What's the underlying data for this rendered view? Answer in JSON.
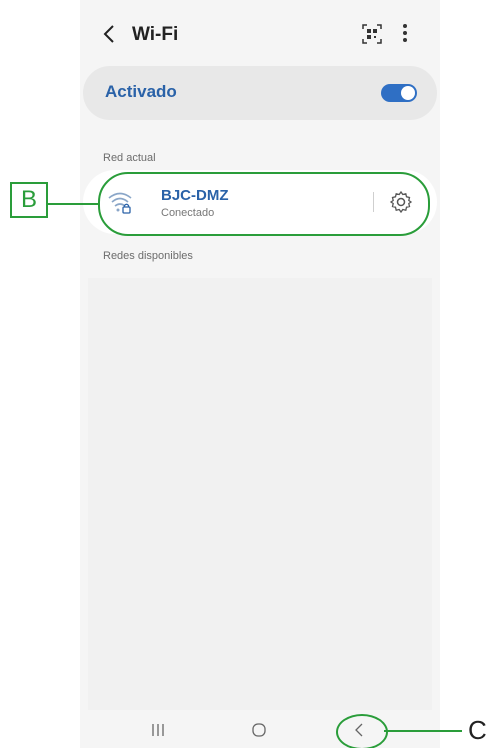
{
  "header": {
    "title": "Wi-Fi"
  },
  "toggle": {
    "label": "Activado",
    "state": "on"
  },
  "current_network": {
    "section_label": "Red actual",
    "name": "BJC-DMZ",
    "status": "Conectado"
  },
  "available": {
    "section_label": "Redes disponibles"
  },
  "annotations": {
    "b_label": "B",
    "c_label": "C"
  },
  "colors": {
    "accent": "#2a62a8",
    "annotation": "#2a9d3a"
  }
}
